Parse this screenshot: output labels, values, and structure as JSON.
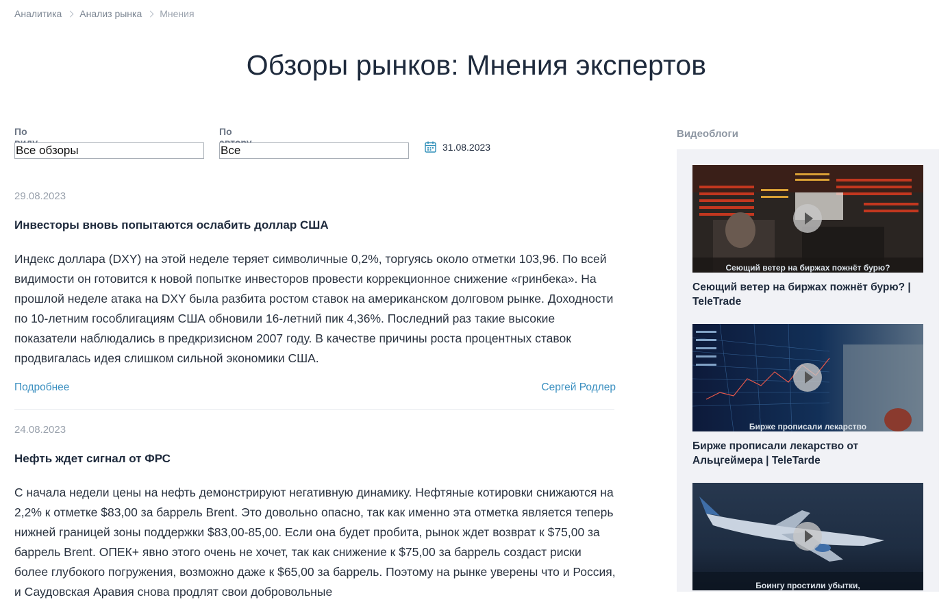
{
  "breadcrumb": {
    "items": [
      "Аналитика",
      "Анализ рынка"
    ],
    "current": "Мнения"
  },
  "page_title": "Обзоры рынков: Мнения экспертов",
  "filters": {
    "market_label": "По виду рынка",
    "market_value": "Все обзоры",
    "author_label": "По автору",
    "author_value": "Все",
    "date_value": "31.08.2023"
  },
  "articles": [
    {
      "date": "29.08.2023",
      "title": "Инвесторы вновь попытаются ослабить доллар США",
      "body": "Индекс доллара (DXY) на этой неделе теряет символичные 0,2%, торгуясь около отметки 103,96. По всей видимости он готовится к новой попытке инвесторов провести коррекционное снижение «гринбека». На прошлой неделе атака на DXY была разбита ростом ставок на американском долговом рынке. Доходности по 10-летним гособлигациям США обновили 16-летний пик 4,36%. Последний раз такие высокие показатели наблюдались в предкризисном 2007 году. В качестве причины роста процентных ставок продвигалась идея слишком сильной экономики США.",
      "more_label": "Подробнее",
      "author": "Сергей Родлер"
    },
    {
      "date": "24.08.2023",
      "title": "Нефть ждет сигнал от ФРС",
      "body": "С начала недели цены на нефть демонстрируют негативную динамику. Нефтяные котировки снижаются на 2,2% к отметке $83,00 за баррель Brent. Это довольно опасно, так как именно эта отметка является теперь нижней границей зоны поддержки $83,00-85,00. Если она будет пробита, рынок ждет возврат к $75,00 за баррель Brent. ОПЕК+ явно этого очень не хочет, так как снижение к $75,00 за баррель создаст риски более глубокого погружения, возможно даже к $65,00 за баррель. Поэтому на рынке уверены что и Россия, и Саудовская Аравия снова продлят свои добровольные"
    }
  ],
  "videoblogs": {
    "title": "Видеоблоги",
    "items": [
      {
        "thumb_caption": "Сеющий ветер на биржах пожнёт бурю?",
        "title": "Сеющий ветер на биржах пожнёт бурю? | TeleTrade"
      },
      {
        "thumb_caption": "Бирже прописали лекарство",
        "title": "Бирже прописали лекарство от Альцгеймера | TeleTarde"
      },
      {
        "thumb_caption": "Боингу простили убытки,",
        "title": ""
      }
    ]
  }
}
